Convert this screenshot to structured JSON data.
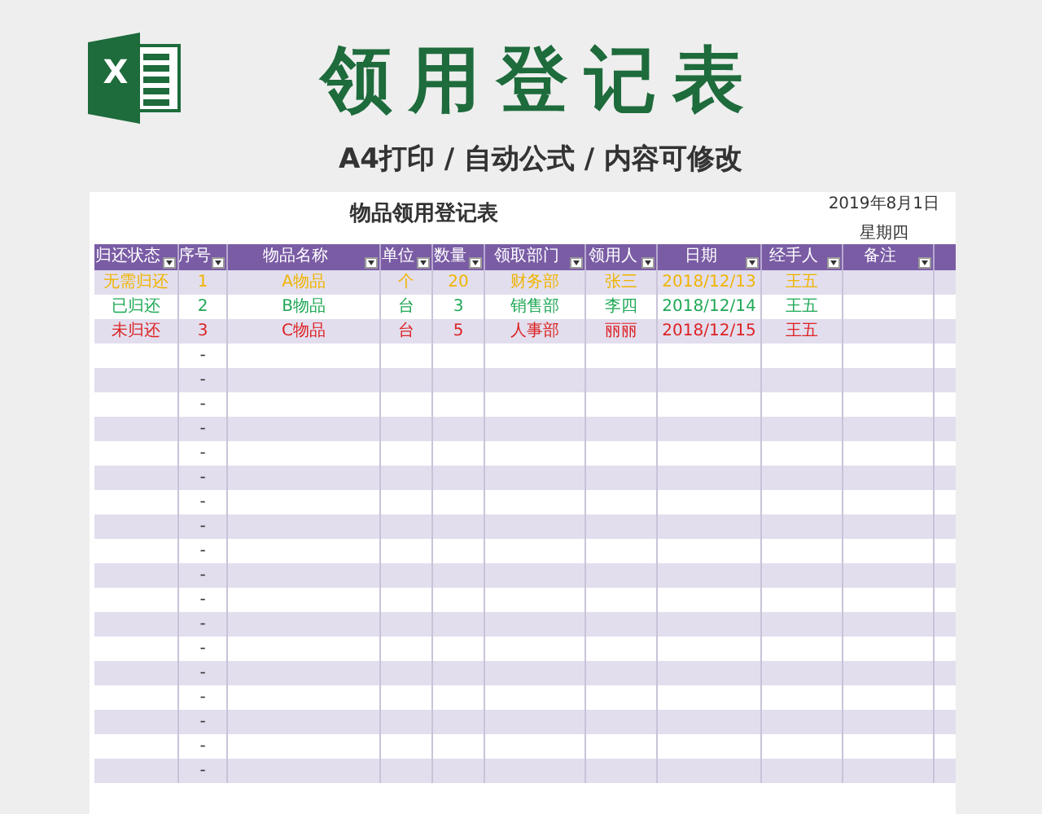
{
  "banner": {
    "logo_letter": "X",
    "title": "领用登记表",
    "subtitle": "A4打印 / 自动公式 / 内容可修改"
  },
  "sheet": {
    "title": "物品领用登记表",
    "date": "2019年8月1日",
    "weekday": "星期四",
    "columns": [
      "归还状态",
      "序号",
      "物品名称",
      "单位",
      "数量",
      "领取部门",
      "领用人",
      "日期",
      "经手人",
      "备注"
    ],
    "rows": [
      {
        "color": "#f0b400",
        "cells": [
          "无需归还",
          "1",
          "A物品",
          "个",
          "20",
          "财务部",
          "张三",
          "2018/12/13",
          "王五",
          ""
        ]
      },
      {
        "color": "#1fa855",
        "cells": [
          "已归还",
          "2",
          "B物品",
          "台",
          "3",
          "销售部",
          "李四",
          "2018/12/14",
          "王五",
          ""
        ]
      },
      {
        "color": "#dd2222",
        "cells": [
          "未归还",
          "3",
          "C物品",
          "台",
          "5",
          "人事部",
          "丽丽",
          "2018/12/15",
          "王五",
          ""
        ]
      },
      {
        "cells": [
          "",
          "-"
        ]
      },
      {
        "cells": [
          "",
          "-"
        ]
      },
      {
        "cells": [
          "",
          "-"
        ]
      },
      {
        "cells": [
          "",
          "-"
        ]
      },
      {
        "cells": [
          "",
          "-"
        ]
      },
      {
        "cells": [
          "",
          "-"
        ]
      },
      {
        "cells": [
          "",
          "-"
        ]
      },
      {
        "cells": [
          "",
          "-"
        ]
      },
      {
        "cells": [
          "",
          "-"
        ]
      },
      {
        "cells": [
          "",
          "-"
        ]
      },
      {
        "cells": [
          "",
          "-"
        ]
      },
      {
        "cells": [
          "",
          "-"
        ]
      },
      {
        "cells": [
          "",
          "-"
        ]
      },
      {
        "cells": [
          "",
          "-"
        ]
      },
      {
        "cells": [
          "",
          "-"
        ]
      },
      {
        "cells": [
          "",
          "-"
        ]
      },
      {
        "cells": [
          "",
          "-"
        ]
      },
      {
        "cells": [
          "",
          "-"
        ]
      }
    ]
  }
}
